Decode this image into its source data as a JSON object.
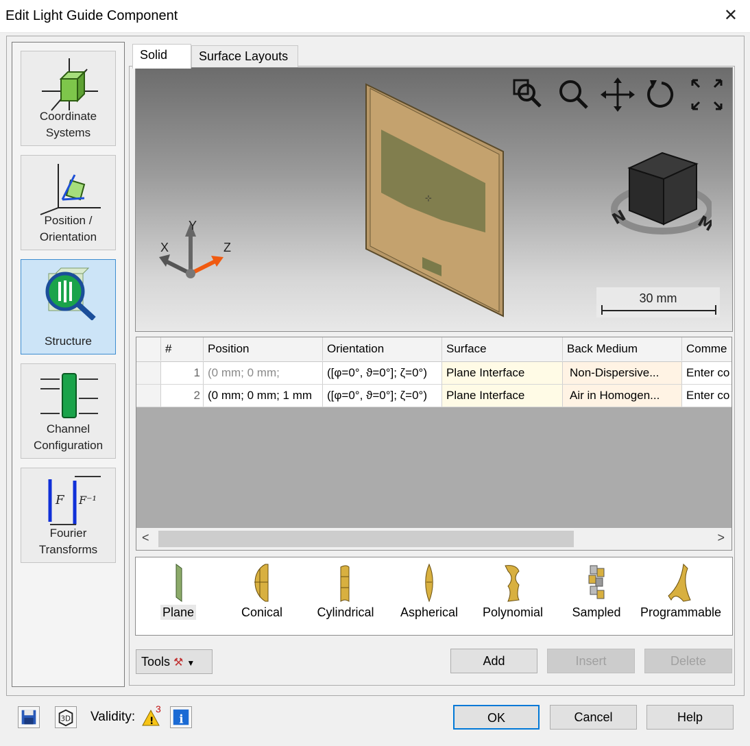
{
  "window": {
    "title": "Edit Light Guide Component",
    "close_glyph": "✕"
  },
  "sidebar": {
    "items": [
      {
        "label_line1": "Coordinate",
        "label_line2": "Systems",
        "icon": "coordinate-systems-icon"
      },
      {
        "label_line1": "Position /",
        "label_line2": "Orientation",
        "icon": "position-orientation-icon"
      },
      {
        "label_line1": "Structure",
        "label_line2": "",
        "icon": "structure-icon",
        "active": true
      },
      {
        "label_line1": "Channel",
        "label_line2": "Configuration",
        "icon": "channel-configuration-icon"
      },
      {
        "label_line1": "Fourier",
        "label_line2": "Transforms",
        "icon": "fourier-transforms-icon"
      }
    ]
  },
  "tabs": [
    {
      "label": "Solid",
      "active": true
    },
    {
      "label": "Surface Layouts",
      "active": false
    }
  ],
  "viewport": {
    "axes": {
      "x": "X",
      "y": "Y",
      "z": "Z"
    },
    "scale_label": "30 mm",
    "tools": [
      "zoom-region-icon",
      "zoom-icon",
      "pan-icon",
      "rotate-icon",
      "fit-view-icon"
    ]
  },
  "table": {
    "columns": [
      "#",
      "Position",
      "Orientation",
      "Surface",
      "Back Medium",
      "Comme"
    ],
    "rows": [
      {
        "num": "1",
        "position": "(0 mm; 0 mm;",
        "orientation": "([φ=0°, ϑ=0°]; ζ=0°)",
        "surface": "Plane Interface",
        "medium": "Non-Dispersive...",
        "comment": "Enter co"
      },
      {
        "num": "2",
        "position": "(0 mm; 0 mm; 1 mm",
        "orientation": "([φ=0°, ϑ=0°]; ζ=0°)",
        "surface": "Plane Interface",
        "medium": "Air in Homogen...",
        "comment": "Enter co"
      }
    ],
    "scroll_left": "<",
    "scroll_right": ">"
  },
  "surfaces": [
    {
      "label": "Plane",
      "selected": true
    },
    {
      "label": "Conical"
    },
    {
      "label": "Cylindrical"
    },
    {
      "label": "Aspherical"
    },
    {
      "label": "Polynomial"
    },
    {
      "label": "Sampled"
    },
    {
      "label": "Programmable"
    }
  ],
  "actions": {
    "tools": "Tools",
    "add": "Add",
    "insert": "Insert",
    "delete": "Delete"
  },
  "footer": {
    "validity_label": "Validity:",
    "warning_count": "3",
    "ok": "OK",
    "cancel": "Cancel",
    "help": "Help"
  },
  "colors": {
    "accent": "#0078d7",
    "active_bg": "#cce4f7",
    "surface_yellow": "#fffbe6"
  }
}
